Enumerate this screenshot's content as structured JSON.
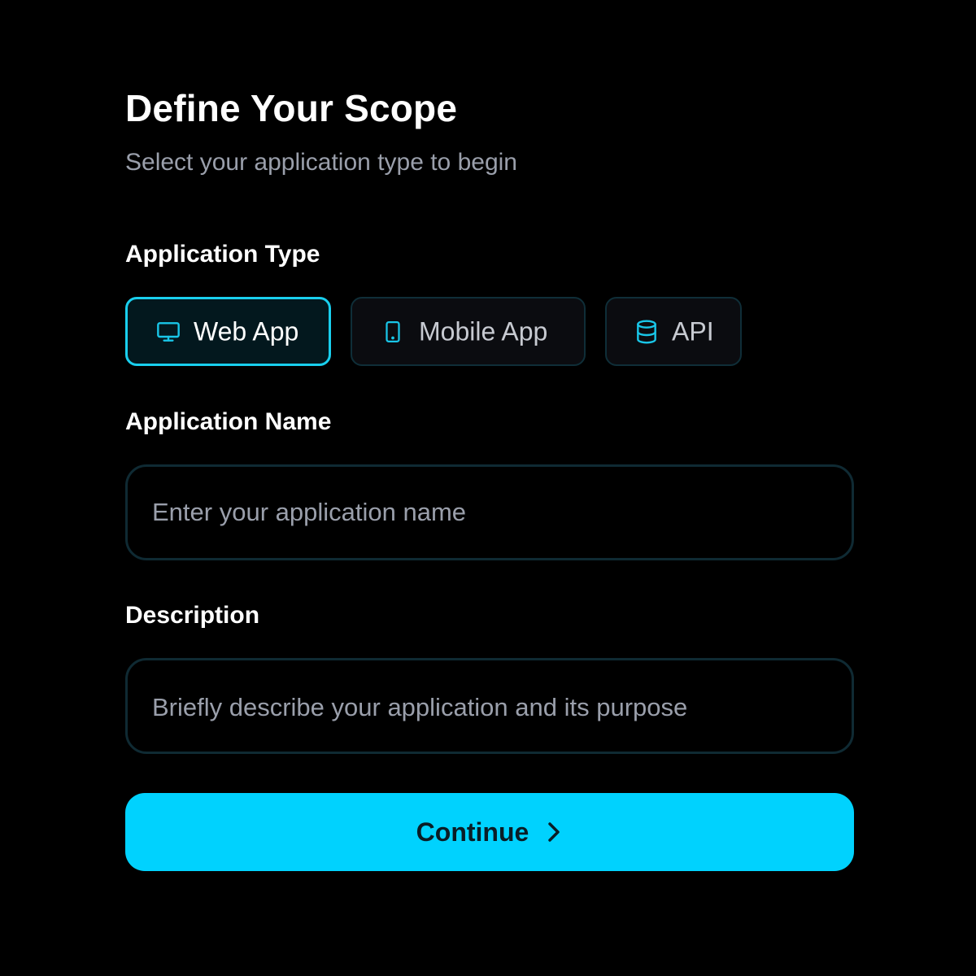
{
  "header": {
    "title": "Define Your Scope",
    "subtitle": "Select your application type to begin"
  },
  "app_type": {
    "label": "Application Type",
    "options": [
      {
        "label": "Web App",
        "icon": "monitor-icon",
        "selected": true
      },
      {
        "label": "Mobile App",
        "icon": "smartphone-icon",
        "selected": false
      },
      {
        "label": "API",
        "icon": "database-icon",
        "selected": false
      }
    ]
  },
  "app_name": {
    "label": "Application Name",
    "placeholder": "Enter your application name",
    "value": ""
  },
  "description": {
    "label": "Description",
    "placeholder": "Briefly describe your application and its purpose",
    "value": ""
  },
  "actions": {
    "continue_label": "Continue",
    "continue_icon": "chevron-right-icon"
  },
  "colors": {
    "background": "#000000",
    "accent": "#00d2fe",
    "selected_border": "#19cfee",
    "field_border": "#0f2a33",
    "muted_text": "#9a9fab"
  }
}
